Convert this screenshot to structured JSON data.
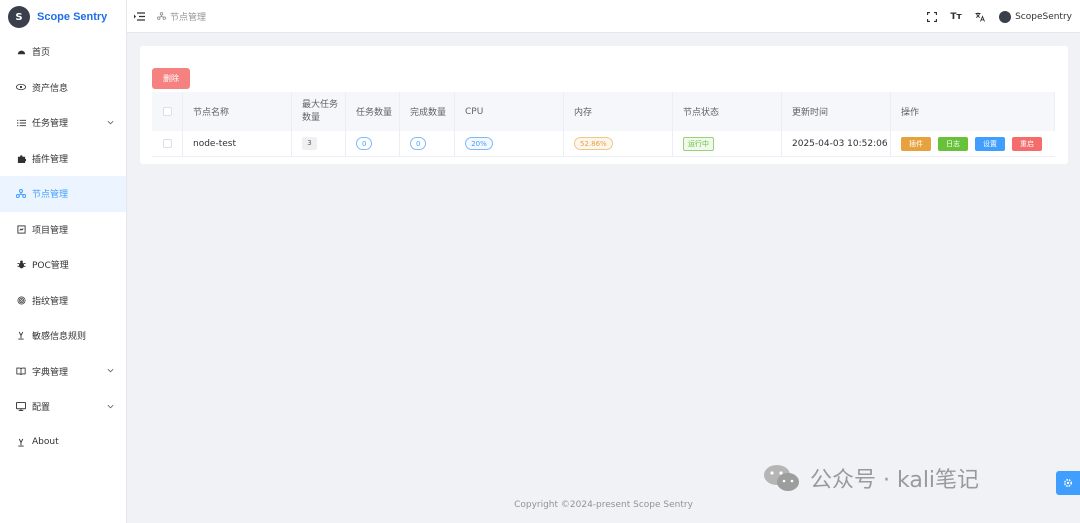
{
  "app": {
    "logo_letter": "S",
    "title": "Scope Sentry"
  },
  "sidebar": {
    "items": [
      {
        "label": "首页",
        "icon": "dashboard-icon",
        "active": false,
        "has_children": false
      },
      {
        "label": "资产信息",
        "icon": "eye-icon",
        "active": false,
        "has_children": false
      },
      {
        "label": "任务管理",
        "icon": "list-icon",
        "active": false,
        "has_children": true
      },
      {
        "label": "插件管理",
        "icon": "puzzle-icon",
        "active": false,
        "has_children": false
      },
      {
        "label": "节点管理",
        "icon": "nodes-icon",
        "active": true,
        "has_children": false
      },
      {
        "label": "项目管理",
        "icon": "project-icon",
        "active": false,
        "has_children": false
      },
      {
        "label": "POC管理",
        "icon": "bug-icon",
        "active": false,
        "has_children": false
      },
      {
        "label": "指纹管理",
        "icon": "fingerprint-icon",
        "active": false,
        "has_children": false
      },
      {
        "label": "敏感信息规则",
        "icon": "rule-icon",
        "active": false,
        "has_children": false
      },
      {
        "label": "字典管理",
        "icon": "book-icon",
        "active": false,
        "has_children": true
      },
      {
        "label": "配置",
        "icon": "monitor-icon",
        "active": false,
        "has_children": true
      },
      {
        "label": "About",
        "icon": "info-icon",
        "active": false,
        "has_children": false
      }
    ]
  },
  "header": {
    "breadcrumb": "节点管理",
    "tools": {
      "size_label": "Tт"
    },
    "username": "ScopeSentry"
  },
  "toolbar": {
    "delete_label": "删除"
  },
  "table": {
    "columns": [
      "节点名称",
      "最大任务数量",
      "任务数量",
      "完成数量",
      "CPU",
      "内存",
      "节点状态",
      "更新时间",
      "操作"
    ],
    "rows": [
      {
        "name": "node-test",
        "max_tasks": "3",
        "tasks": "0",
        "completed": "0",
        "cpu": "20%",
        "memory": "52.86%",
        "status": "运行中",
        "updated": "2025-04-03 10:52:06",
        "actions": {
          "plugin": "插件",
          "log": "日志",
          "settings": "设置",
          "restart": "重启"
        }
      }
    ]
  },
  "footer": {
    "copyright": "Copyright ©2024-present Scope Sentry"
  },
  "watermark": {
    "text": "公众号 · kali笔记"
  },
  "colors": {
    "primary": "#409eff",
    "danger": "#f56c6c",
    "warning": "#e6a23c",
    "success": "#67c23a"
  }
}
